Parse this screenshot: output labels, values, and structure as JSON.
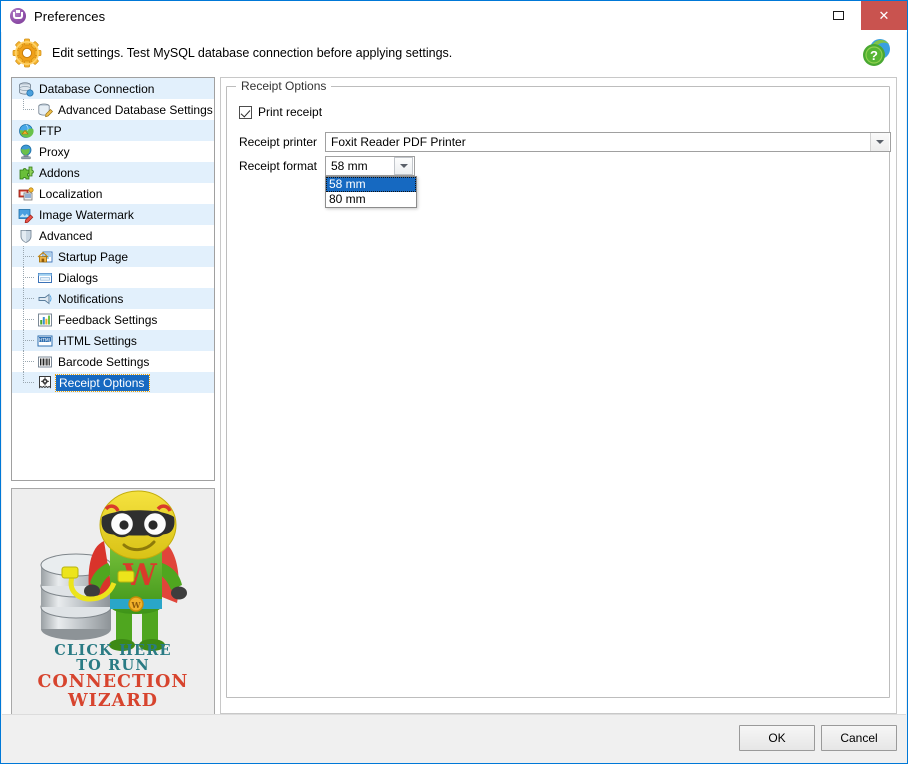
{
  "window": {
    "title": "Preferences",
    "title_icon": "app-logo-icon",
    "maximize_label": "Maximize",
    "close_label": "Close"
  },
  "header": {
    "icon": "gear-icon",
    "text": "Edit settings. Test MySQL database connection before applying settings.",
    "help_icon": "help-globe-icon"
  },
  "sidebar": {
    "items": [
      {
        "label": "Database Connection",
        "icon": "database-icon",
        "level": 0,
        "selected": false
      },
      {
        "label": "Advanced Database Settings",
        "icon": "database-edit-icon",
        "level": 1,
        "selected": false
      },
      {
        "label": "FTP",
        "icon": "ftp-globe-icon",
        "level": 0,
        "selected": false
      },
      {
        "label": "Proxy",
        "icon": "proxy-globe-icon",
        "level": 0,
        "selected": false
      },
      {
        "label": "Addons",
        "icon": "addons-puzzle-icon",
        "level": 0,
        "selected": false
      },
      {
        "label": "Localization",
        "icon": "localization-icon",
        "level": 0,
        "selected": false
      },
      {
        "label": "Image Watermark",
        "icon": "watermark-icon",
        "level": 0,
        "selected": false
      },
      {
        "label": "Advanced",
        "icon": "shield-icon",
        "level": 0,
        "selected": false
      },
      {
        "label": "Startup Page",
        "icon": "home-page-icon",
        "level": 1,
        "selected": false
      },
      {
        "label": "Dialogs",
        "icon": "dialog-icon",
        "level": 1,
        "selected": false
      },
      {
        "label": "Notifications",
        "icon": "notification-icon",
        "level": 1,
        "selected": false
      },
      {
        "label": "Feedback Settings",
        "icon": "chart-icon",
        "level": 1,
        "selected": false
      },
      {
        "label": "HTML Settings",
        "icon": "html-icon",
        "level": 1,
        "selected": false
      },
      {
        "label": "Barcode Settings",
        "icon": "barcode-icon",
        "level": 1,
        "selected": false
      },
      {
        "label": "Receipt Options",
        "icon": "receipt-icon",
        "level": 1,
        "selected": true
      }
    ]
  },
  "promo": {
    "line1": "CLICK HERE",
    "line2": "TO RUN",
    "line3": "CONNECTION",
    "line4": "WIZARD",
    "art": "database-superhero-mascot",
    "color_teal": "#2a7b84",
    "color_red": "#d7442e"
  },
  "main": {
    "group_title": "Receipt Options",
    "print_receipt": {
      "label": "Print receipt",
      "checked": true
    },
    "printer": {
      "label": "Receipt printer",
      "value": "Foxit Reader PDF Printer"
    },
    "format": {
      "label": "Receipt format",
      "value": "58 mm",
      "open": true,
      "options": [
        "58 mm",
        "80 mm"
      ],
      "selected_index": 0
    }
  },
  "footer": {
    "ok_label": "OK",
    "cancel_label": "Cancel"
  },
  "colors": {
    "accent": "#0078d7",
    "selection": "#1669c1",
    "row_alt": "#e2f0fc",
    "close_button": "#c9534f"
  }
}
